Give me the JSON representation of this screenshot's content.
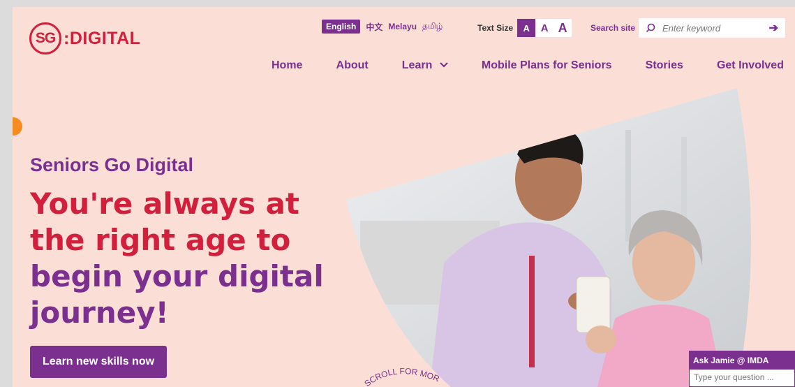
{
  "logo": {
    "mark": "SG",
    "text": ":DIGITAL"
  },
  "languages": [
    "English",
    "中文",
    "Melayu",
    "தமிழ்"
  ],
  "text_size": {
    "label": "Text Size",
    "options": [
      "A",
      "A",
      "A"
    ]
  },
  "search": {
    "label": "Search site",
    "placeholder": "Enter keyword",
    "submit_icon": "arrow-right-icon"
  },
  "nav": [
    "Home",
    "About",
    "Learn",
    "Mobile Plans for Seniors",
    "Stories",
    "Get Involved"
  ],
  "hero": {
    "subtitle": "Seniors Go Digital",
    "headline_lines": [
      "You're always at",
      "the right age to",
      "begin your digital",
      "journey!"
    ],
    "cta": "Learn new skills now",
    "scroll_hint_text": "SCROLL FOR MORE"
  },
  "chat": {
    "title": "Ask Jamie @ IMDA",
    "placeholder": "Type your question ..."
  },
  "colors": {
    "brand_red": "#d21f3c",
    "brand_purple": "#7b2f8e",
    "background": "#fbdfd6",
    "accent_orange": "#f68b1f"
  }
}
